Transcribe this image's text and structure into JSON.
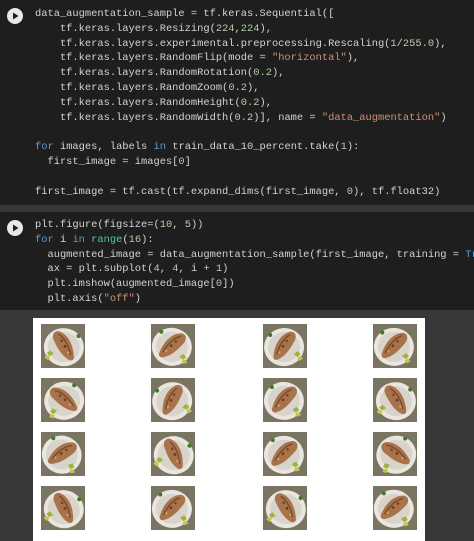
{
  "cells": [
    {
      "id": "cell1",
      "lines": [
        [
          {
            "t": "data_augmentation_sample = tf.keras.Sequential(["
          }
        ],
        [
          {
            "t": "    tf.keras.layers.Resizing("
          },
          {
            "t": "224",
            "c": "num"
          },
          {
            "t": ","
          },
          {
            "t": "224",
            "c": "num"
          },
          {
            "t": "),"
          }
        ],
        [
          {
            "t": "    tf.keras.layers.experimental.preprocessing.Rescaling("
          },
          {
            "t": "1",
            "c": "num"
          },
          {
            "t": "/"
          },
          {
            "t": "255.0",
            "c": "num"
          },
          {
            "t": "),"
          }
        ],
        [
          {
            "t": "    tf.keras.layers.RandomFlip(mode = "
          },
          {
            "t": "\"horizontal\"",
            "c": "str"
          },
          {
            "t": "),"
          }
        ],
        [
          {
            "t": "    tf.keras.layers.RandomRotation("
          },
          {
            "t": "0.2",
            "c": "num"
          },
          {
            "t": "),"
          }
        ],
        [
          {
            "t": "    tf.keras.layers.RandomZoom("
          },
          {
            "t": "0.2",
            "c": "num"
          },
          {
            "t": "),"
          }
        ],
        [
          {
            "t": "    tf.keras.layers.RandomHeight("
          },
          {
            "t": "0.2",
            "c": "num"
          },
          {
            "t": "),"
          }
        ],
        [
          {
            "t": "    tf.keras.layers.RandomWidth("
          },
          {
            "t": "0.2",
            "c": "num"
          },
          {
            "t": ")], name = "
          },
          {
            "t": "\"data_augmentation\"",
            "c": "str"
          },
          {
            "t": ")"
          }
        ],
        [
          {
            "t": ""
          }
        ],
        [
          {
            "t": "for",
            "c": "kw"
          },
          {
            "t": " images, labels "
          },
          {
            "t": "in",
            "c": "kw"
          },
          {
            "t": " train_data_10_percent.take("
          },
          {
            "t": "1",
            "c": "num"
          },
          {
            "t": "):"
          }
        ],
        [
          {
            "t": "  first_image = images["
          },
          {
            "t": "0",
            "c": "num"
          },
          {
            "t": "]"
          }
        ],
        [
          {
            "t": ""
          }
        ],
        [
          {
            "t": "first_image = tf.cast(tf.expand_dims(first_image, "
          },
          {
            "t": "0",
            "c": "num"
          },
          {
            "t": "), tf.float32)"
          }
        ]
      ]
    },
    {
      "id": "cell2",
      "lines": [
        [
          {
            "t": "plt.figure(figsize=("
          },
          {
            "t": "10",
            "c": "num"
          },
          {
            "t": ", "
          },
          {
            "t": "5",
            "c": "num"
          },
          {
            "t": "))"
          }
        ],
        [
          {
            "t": "for",
            "c": "kw"
          },
          {
            "t": " i "
          },
          {
            "t": "in",
            "c": "kw"
          },
          {
            "t": " "
          },
          {
            "t": "range",
            "c": "bi"
          },
          {
            "t": "("
          },
          {
            "t": "16",
            "c": "num"
          },
          {
            "t": "):"
          }
        ],
        [
          {
            "t": "  augmented_image = data_augmentation_sample(first_image, training = "
          },
          {
            "t": "True",
            "c": "kw"
          },
          {
            "t": ")"
          }
        ],
        [
          {
            "t": "  ax = plt.subplot("
          },
          {
            "t": "4",
            "c": "num"
          },
          {
            "t": ", "
          },
          {
            "t": "4",
            "c": "num"
          },
          {
            "t": ", i + "
          },
          {
            "t": "1",
            "c": "num"
          },
          {
            "t": ")"
          }
        ],
        [
          {
            "t": "  plt.imshow(augmented_image["
          },
          {
            "t": "0",
            "c": "num"
          },
          {
            "t": "])"
          }
        ],
        [
          {
            "t": "  plt.axis("
          },
          {
            "t": "\"off\"",
            "c": "str"
          },
          {
            "t": ")"
          }
        ]
      ]
    }
  ],
  "run_button_icon": "play-icon",
  "output": {
    "grid_rows": 4,
    "grid_cols": 4,
    "images": [
      {
        "flip": true,
        "rot": -8
      },
      {
        "flip": false,
        "rot": 10
      },
      {
        "flip": false,
        "rot": -4
      },
      {
        "flip": false,
        "rot": 6
      },
      {
        "flip": true,
        "rot": 12
      },
      {
        "flip": false,
        "rot": -10
      },
      {
        "flip": false,
        "rot": 4
      },
      {
        "flip": true,
        "rot": -6
      },
      {
        "flip": false,
        "rot": 18
      },
      {
        "flip": true,
        "rot": -14
      },
      {
        "flip": false,
        "rot": 8
      },
      {
        "flip": true,
        "rot": 16
      },
      {
        "flip": true,
        "rot": -12
      },
      {
        "flip": false,
        "rot": 6
      },
      {
        "flip": true,
        "rot": -8
      },
      {
        "flip": false,
        "rot": 12
      }
    ]
  },
  "colors": {
    "editor_bg": "#1e1e1e",
    "page_bg": "#383838",
    "keyword": "#569cd6",
    "number": "#b5cea8",
    "string": "#ce9178",
    "builtin": "#4ec9b0"
  }
}
